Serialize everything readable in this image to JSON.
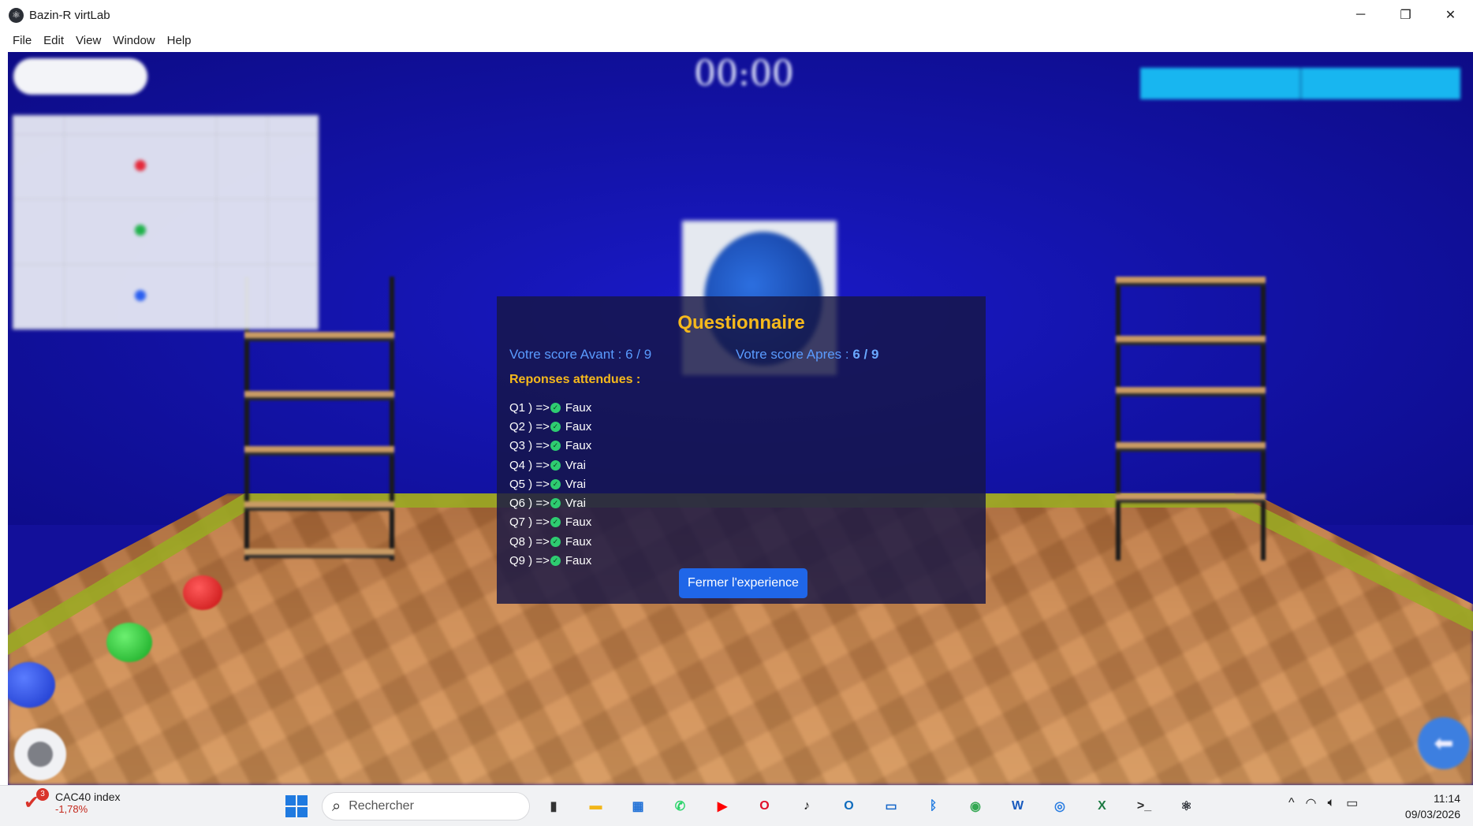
{
  "window": {
    "title": "Bazin-R virtLab"
  },
  "window_controls": {
    "minimize": "─",
    "restore": "❐",
    "close": "✕"
  },
  "menu": [
    "File",
    "Edit",
    "View",
    "Window",
    "Help"
  ],
  "dialog": {
    "title": "Questionnaire",
    "score_before_label": "Votre score Avant :",
    "score_before": "6 / 9",
    "score_after_label": "Votre score Apres :",
    "score_after": "6 / 9",
    "answers_label": "Reponses attendues :",
    "answers": [
      {
        "q": "Q1 ) =>",
        "a": "Faux"
      },
      {
        "q": "Q2 ) =>",
        "a": "Faux"
      },
      {
        "q": "Q3 ) =>",
        "a": "Faux"
      },
      {
        "q": "Q4 ) =>",
        "a": "Vrai"
      },
      {
        "q": "Q5 ) =>",
        "a": "Vrai"
      },
      {
        "q": "Q6 ) =>",
        "a": "Vrai"
      },
      {
        "q": "Q7 ) =>",
        "a": "Faux"
      },
      {
        "q": "Q8 ) =>",
        "a": "Faux"
      },
      {
        "q": "Q9 ) =>",
        "a": "Faux"
      }
    ],
    "close_label": "Fermer l'experience"
  },
  "scene": {
    "timer": "00:00",
    "legend_dots": [
      "#e5293a",
      "#1fb24a",
      "#2a5ff0"
    ],
    "balls": [
      "#e01b1b",
      "#18c228",
      "#1a3fe0"
    ]
  },
  "taskbar": {
    "stock_name": "CAC40 index",
    "stock_change": "-1,78%",
    "stock_badge": "3",
    "search_placeholder": "Rechercher",
    "apps": [
      {
        "name": "task-view-icon",
        "glyph": "▮",
        "color": "#333333"
      },
      {
        "name": "file-explorer-icon",
        "glyph": "▬",
        "color": "#f2b619"
      },
      {
        "name": "store-icon",
        "glyph": "▦",
        "color": "#1d6fd6"
      },
      {
        "name": "whatsapp-icon",
        "glyph": "✆",
        "color": "#25d366"
      },
      {
        "name": "youtube-icon",
        "glyph": "▶",
        "color": "#ff0000"
      },
      {
        "name": "opera-icon",
        "glyph": "O",
        "color": "#e0102a"
      },
      {
        "name": "tiktok-icon",
        "glyph": "♪",
        "color": "#111111"
      },
      {
        "name": "outlook-icon",
        "glyph": "O",
        "color": "#0f6cbd"
      },
      {
        "name": "remote-desktop-icon",
        "glyph": "▭",
        "color": "#1868c9"
      },
      {
        "name": "bluetooth-icon",
        "glyph": "ᛒ",
        "color": "#1f7ae0"
      },
      {
        "name": "chrome-icon",
        "glyph": "◉",
        "color": "#34a853"
      },
      {
        "name": "word-icon",
        "glyph": "W",
        "color": "#185abd"
      },
      {
        "name": "quick-assist-icon",
        "glyph": "◎",
        "color": "#2a7de1"
      },
      {
        "name": "excel-icon",
        "glyph": "X",
        "color": "#1d7a43"
      },
      {
        "name": "terminal-icon",
        "glyph": ">_",
        "color": "#2b2b2b"
      },
      {
        "name": "virtlab-icon",
        "glyph": "⚛",
        "color": "#2b2f36"
      }
    ],
    "tray_chevron": "^",
    "time": "11:14",
    "date": "09/03/2026"
  }
}
